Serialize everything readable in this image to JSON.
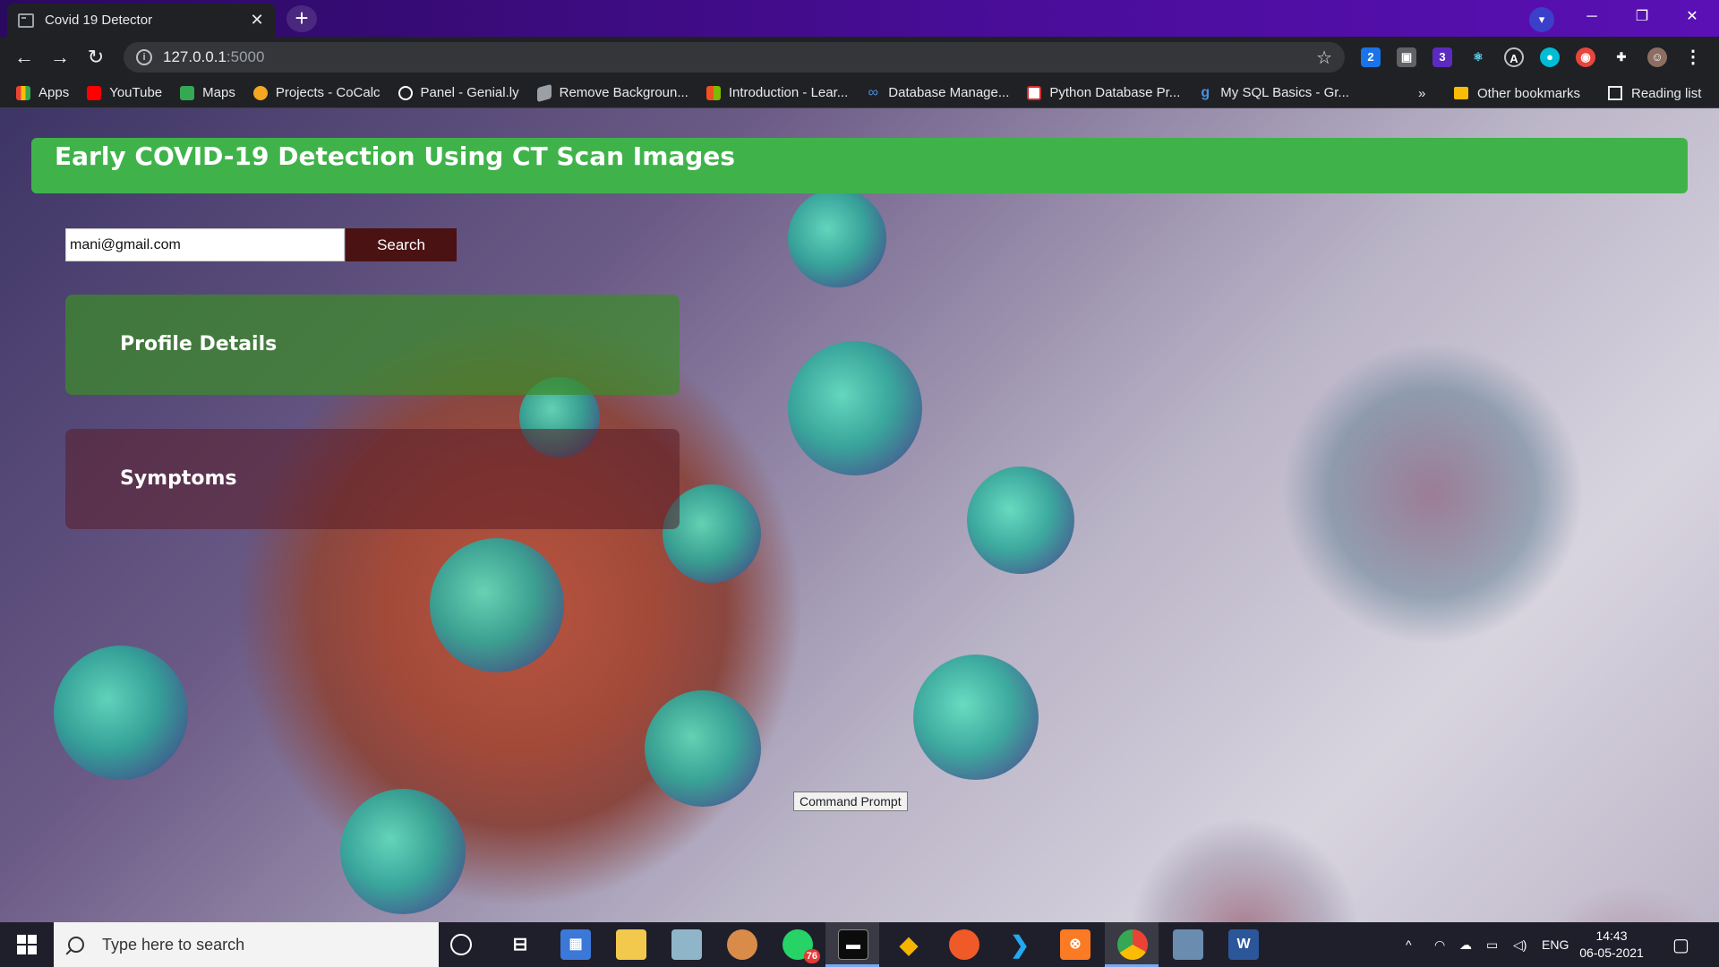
{
  "browser": {
    "tab_title": "Covid 19 Detector",
    "tab_close": "✕",
    "new_tab": "+",
    "url_host": "127.0.0.1",
    "url_port": ":5000",
    "window_controls": {
      "minimize": "─",
      "restore": "❐",
      "close": "✕"
    },
    "extensions": [
      "2",
      "3"
    ],
    "bookmarks": [
      {
        "label": "Apps",
        "icon": "apps-grid-icon",
        "color": "#ea4335"
      },
      {
        "label": "YouTube",
        "icon": "youtube-icon",
        "color": "#ff0000"
      },
      {
        "label": "Maps",
        "icon": "maps-icon",
        "color": "#34a853"
      },
      {
        "label": "Projects - CoCalc",
        "icon": "cocalc-icon",
        "color": "#f5a623"
      },
      {
        "label": "Panel - Genial.ly",
        "icon": "genially-icon",
        "color": "#ffffff"
      },
      {
        "label": "Remove Backgroun...",
        "icon": "removebg-icon",
        "color": "#9aa0a6"
      },
      {
        "label": "Introduction - Lear...",
        "icon": "microsoft-icon",
        "color": "#f25022"
      },
      {
        "label": "Database Manage...",
        "icon": "infinity-icon",
        "color": "#4a90e2"
      },
      {
        "label": "Python Database Pr...",
        "icon": "tutorial-icon",
        "color": "#d32f2f"
      },
      {
        "label": "My SQL Basics - Gr...",
        "icon": "gfg-icon",
        "color": "#2f8d46"
      }
    ],
    "bookmarks_overflow": "»",
    "other_bookmarks": "Other bookmarks",
    "reading_list": "Reading list"
  },
  "page": {
    "banner_title": "Early COVID-19 Detection Using CT Scan Images",
    "search": {
      "value": "mani@gmail.com",
      "button_label": "Search"
    },
    "panels": {
      "profile": "Profile Details",
      "symptoms": "Symptoms"
    },
    "colors": {
      "banner": "#3fb34a",
      "search_button": "#4a1212"
    }
  },
  "tooltip": "Command Prompt",
  "taskbar": {
    "search_placeholder": "Type here to search",
    "whatsapp_badge": "76",
    "language": "ENG",
    "time": "14:43",
    "date": "06-05-2021"
  }
}
